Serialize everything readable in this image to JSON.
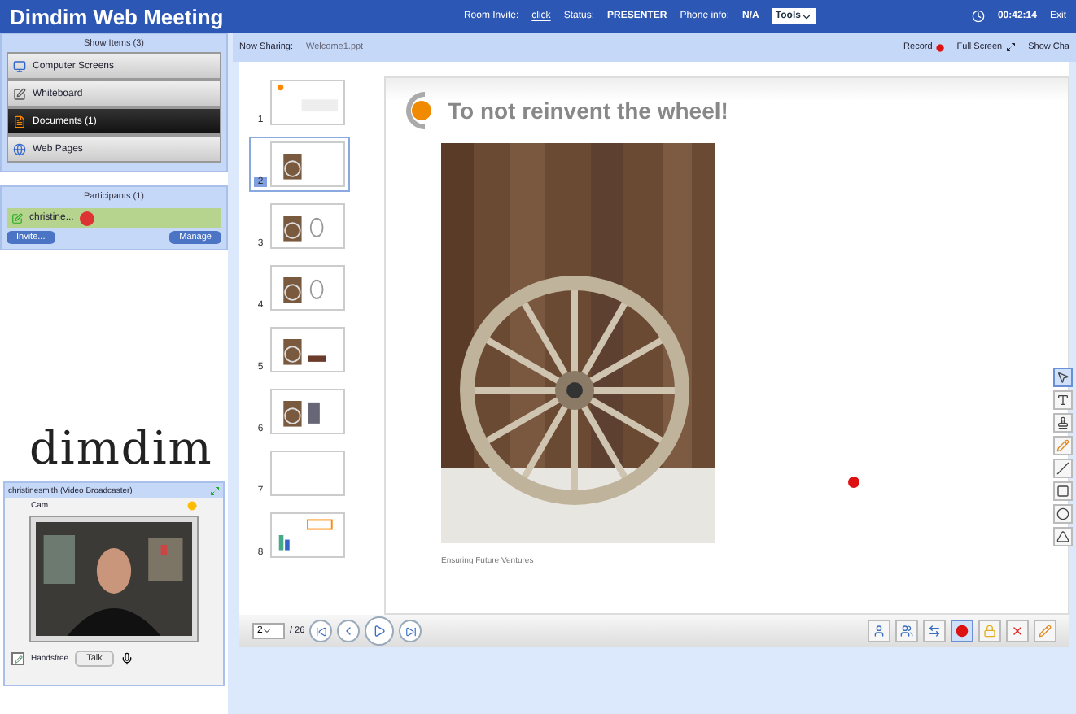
{
  "app_title": "Dimdim Web Meeting",
  "header": {
    "room_invite_label": "Room Invite:",
    "room_invite_link": "click",
    "status_label": "Status:",
    "status_value": "PRESENTER",
    "phone_label": "Phone info:",
    "phone_value": "N/A",
    "tools_menu": "Tools",
    "timer": "00:42:14",
    "exit_label": "Exit"
  },
  "show_items": {
    "title": "Show Items (3)",
    "items": [
      {
        "kind": "screen",
        "label": "Computer Screens",
        "selected": false
      },
      {
        "kind": "whiteboard",
        "label": "Whiteboard",
        "selected": false
      },
      {
        "kind": "document",
        "label": "Documents (1)",
        "selected": true
      },
      {
        "kind": "web",
        "label": "Web Pages",
        "selected": false
      }
    ]
  },
  "participants": {
    "title": "Participants (1)",
    "items": [
      {
        "name": "christine...",
        "kind": "presenter"
      }
    ],
    "buttons": [
      "Invite...",
      "Manage"
    ]
  },
  "logo": "dimdim",
  "video": {
    "title": "christinesmith (Video Broadcaster)",
    "label": "Cam",
    "handsfree": {
      "label": "Handsfree",
      "checked": true
    },
    "talk_button": "Talk"
  },
  "sharing": {
    "label": "Now Sharing:",
    "file": "Welcome1.ppt",
    "record": "Record",
    "fullscreen": "Full Screen",
    "chat": "Show Cha"
  },
  "thumbnails": [
    {
      "number": "1",
      "kind": "title",
      "selected": false
    },
    {
      "number": "2",
      "selected": true
    },
    {
      "number": "3",
      "kind": "sketch",
      "selected": false
    },
    {
      "number": "4",
      "kind": "sketch",
      "selected": false
    },
    {
      "number": "5",
      "kind": "object",
      "selected": false
    },
    {
      "number": "6",
      "kind": "door",
      "selected": false
    },
    {
      "number": "7",
      "kind": "blank",
      "selected": false
    },
    {
      "number": "8",
      "kind": "chart",
      "selected": false
    }
  ],
  "slide": {
    "title": "To not reinvent the wheel!",
    "caption": "Ensuring Future Ventures"
  },
  "navigation": {
    "page": "2",
    "total": "/ 26"
  },
  "side_tools": [
    {
      "kind": "pointer",
      "selected": true
    },
    {
      "kind": "text",
      "selected": false
    },
    {
      "kind": "stamp",
      "selected": false
    },
    {
      "kind": "pen",
      "selected": false
    },
    {
      "kind": "line",
      "selected": false
    },
    {
      "kind": "rectangle",
      "selected": false
    },
    {
      "kind": "circle",
      "selected": false
    },
    {
      "kind": "triangle",
      "selected": false
    }
  ],
  "bottom_tools": [
    {
      "kind": "user",
      "selected": false
    },
    {
      "kind": "users",
      "selected": false
    },
    {
      "kind": "swap",
      "selected": false
    },
    {
      "kind": "record",
      "selected": true
    },
    {
      "kind": "lock",
      "selected": false
    },
    {
      "kind": "delete",
      "selected": false
    },
    {
      "kind": "pen",
      "selected": false
    }
  ]
}
